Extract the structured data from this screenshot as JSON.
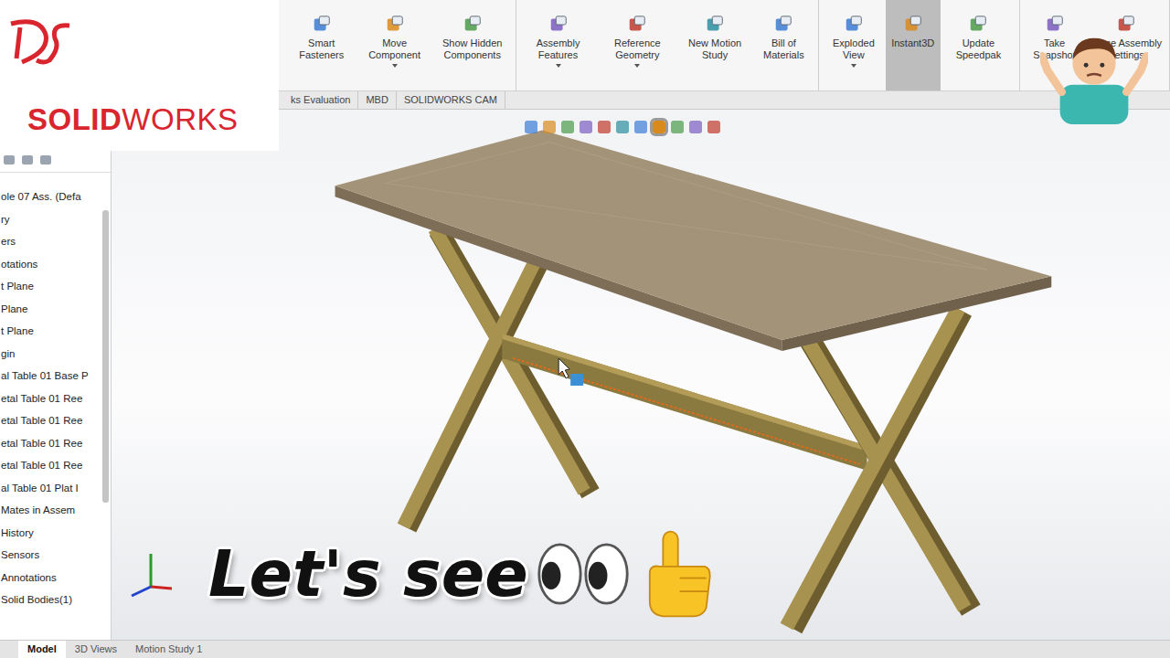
{
  "logo": {
    "brand": [
      "SOLID",
      "WORKS"
    ]
  },
  "ribbon": {
    "groups": [
      {
        "buttons": [
          {
            "label": "Smart Fasteners",
            "selected": false,
            "dropdown": false
          },
          {
            "label": "Move Component",
            "selected": false,
            "dropdown": true
          },
          {
            "label": "Show Hidden Components",
            "selected": false,
            "dropdown": false
          }
        ]
      },
      {
        "buttons": [
          {
            "label": "Assembly Features",
            "selected": false,
            "dropdown": true
          },
          {
            "label": "Reference Geometry",
            "selected": false,
            "dropdown": true
          },
          {
            "label": "New Motion Study",
            "selected": false,
            "dropdown": false
          },
          {
            "label": "Bill of Materials",
            "selected": false,
            "dropdown": false
          }
        ]
      },
      {
        "buttons": [
          {
            "label": "Exploded View",
            "selected": false,
            "dropdown": true
          },
          {
            "label": "Instant3D",
            "selected": true,
            "dropdown": false
          },
          {
            "label": "Update Speedpak",
            "selected": false,
            "dropdown": false
          }
        ]
      },
      {
        "buttons": [
          {
            "label": "Take Snapshot",
            "selected": false,
            "dropdown": false
          },
          {
            "label": "Large Assembly Settings",
            "selected": false,
            "dropdown": false
          }
        ]
      }
    ]
  },
  "tabs": [
    {
      "label": "ks Evaluation",
      "selected": false
    },
    {
      "label": "MBD",
      "selected": false
    },
    {
      "label": "SOLIDWORKS CAM",
      "selected": false
    }
  ],
  "feature_tree": {
    "items": [
      "ole 07 Ass. (Defa",
      "ry",
      "ers",
      "otations",
      "t Plane",
      "Plane",
      "t Plane",
      "gin",
      "al Table 01 Base P",
      "etal Table 01 Ree",
      "etal Table 01 Ree",
      "etal Table 01 Ree",
      "etal Table 01 Ree",
      "al Table 01 Plat I",
      "Mates in Assem",
      "History",
      "Sensors",
      "Annotations",
      "Solid Bodies(1)"
    ]
  },
  "bottom_tabs": [
    {
      "label": "Model",
      "selected": true
    },
    {
      "label": "3D Views",
      "selected": false
    },
    {
      "label": "Motion Study 1",
      "selected": false
    }
  ],
  "caption": {
    "text": "Let's see"
  }
}
